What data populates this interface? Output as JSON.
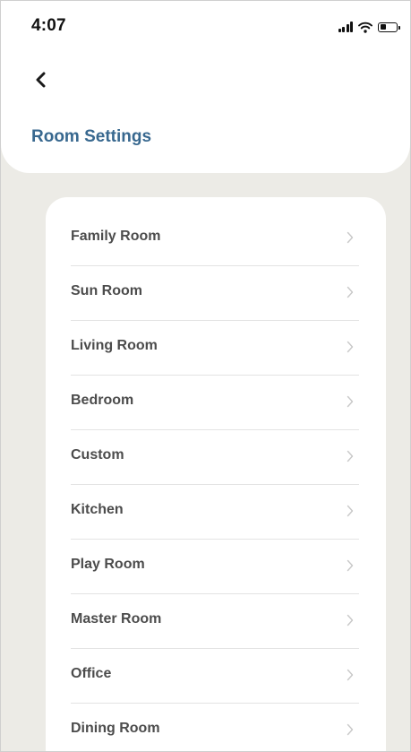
{
  "status_bar": {
    "time": "4:07"
  },
  "header": {
    "title": "Room Settings"
  },
  "rooms": [
    {
      "label": "Family Room"
    },
    {
      "label": "Sun Room"
    },
    {
      "label": "Living Room"
    },
    {
      "label": "Bedroom"
    },
    {
      "label": "Custom"
    },
    {
      "label": "Kitchen"
    },
    {
      "label": "Play Room"
    },
    {
      "label": "Master Room"
    },
    {
      "label": "Office"
    },
    {
      "label": "Dining Room"
    }
  ],
  "icons": {
    "back": "chevron-left-icon",
    "row_arrow": "chevron-right-icon",
    "signal": "cellular-signal-icon",
    "wifi": "wifi-icon",
    "battery": "battery-icon"
  },
  "colors": {
    "background": "#ecebe6",
    "title": "#38688f",
    "row_text": "#4c4c4c",
    "chevron": "#c8c8c8"
  },
  "battery_level": 0.35
}
